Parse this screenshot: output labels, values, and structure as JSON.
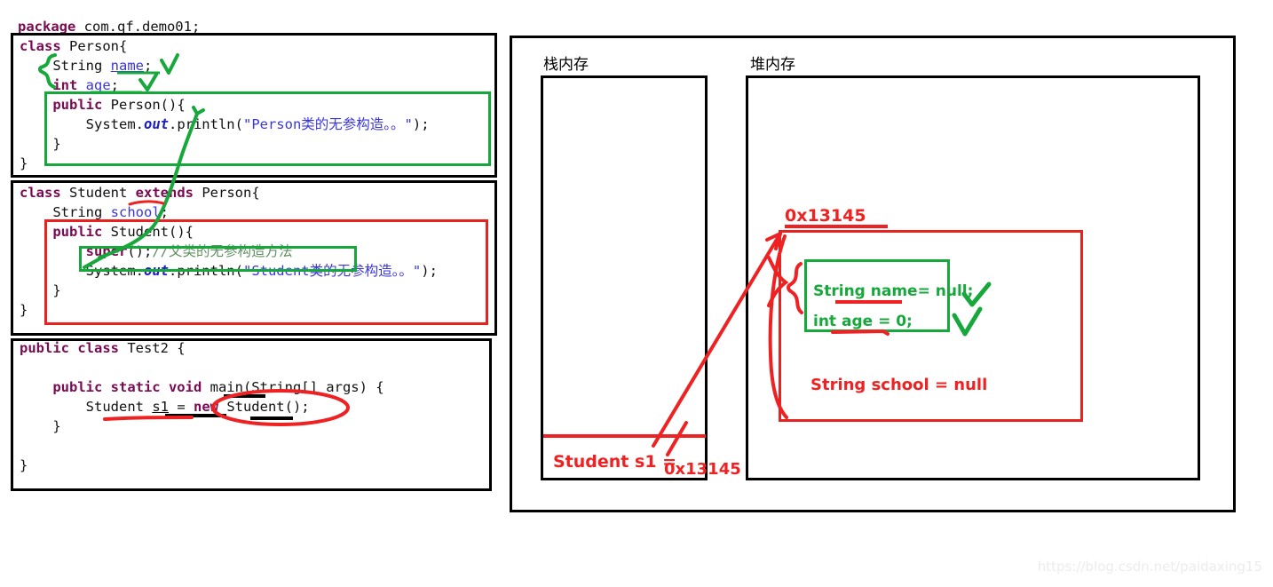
{
  "colors": {
    "keyword": "#7a0a52",
    "string": "#3a36d8",
    "field": "#3a36d8",
    "comment": "#5f8f5f",
    "red_ink": "#ee2222",
    "green_ink": "#17a83c",
    "border_black": "#000000",
    "watermark": "#ececec"
  },
  "code": {
    "package_line": "package com.qf.demo01;",
    "package_keyword": "package",
    "package_value": " com.qf.demo01;",
    "block_person": {
      "lines": [
        {
          "segs": [
            {
              "t": "class",
              "c": "kw"
            },
            {
              "t": " Person{",
              "c": "plain"
            }
          ]
        },
        {
          "segs": [
            {
              "t": "    String ",
              "c": "plain"
            },
            {
              "t": "name",
              "c": "fldu"
            },
            {
              "t": ";",
              "c": "plain"
            }
          ]
        },
        {
          "segs": [
            {
              "t": "    int",
              "c": "kw"
            },
            {
              "t": " ",
              "c": "plain"
            },
            {
              "t": "age",
              "c": "fld"
            },
            {
              "t": ";",
              "c": "plain"
            }
          ]
        },
        {
          "segs": [
            {
              "t": "    public",
              "c": "kw"
            },
            {
              "t": " Person(){",
              "c": "plain"
            }
          ]
        },
        {
          "segs": [
            {
              "t": "        System.",
              "c": "plain"
            },
            {
              "t": "out",
              "c": "out"
            },
            {
              "t": ".println(",
              "c": "plain"
            },
            {
              "t": "\"Person类的无参构造。。\"",
              "c": "str"
            },
            {
              "t": ");",
              "c": "plain"
            }
          ]
        },
        {
          "segs": [
            {
              "t": "    }",
              "c": "plain"
            }
          ]
        },
        {
          "segs": [
            {
              "t": "}",
              "c": "plain"
            }
          ]
        }
      ]
    },
    "block_student": {
      "lines": [
        {
          "segs": [
            {
              "t": "class",
              "c": "kw"
            },
            {
              "t": " Student ",
              "c": "plain"
            },
            {
              "t": "extends",
              "c": "kw"
            },
            {
              "t": " Person{",
              "c": "plain"
            }
          ]
        },
        {
          "segs": [
            {
              "t": "    String ",
              "c": "plain"
            },
            {
              "t": "school",
              "c": "fld"
            },
            {
              "t": ";",
              "c": "plain"
            }
          ]
        },
        {
          "segs": [
            {
              "t": "    public",
              "c": "kw"
            },
            {
              "t": " Student(){",
              "c": "plain"
            }
          ]
        },
        {
          "segs": [
            {
              "t": "        super",
              "c": "kw"
            },
            {
              "t": "();",
              "c": "plain"
            },
            {
              "t": "//父类的无参构造方法",
              "c": "cmt"
            }
          ]
        },
        {
          "segs": [
            {
              "t": "        System.",
              "c": "plain"
            },
            {
              "t": "out",
              "c": "out"
            },
            {
              "t": ".println(",
              "c": "plain"
            },
            {
              "t": "\"Student类的无参构造。。\"",
              "c": "str"
            },
            {
              "t": ");",
              "c": "plain"
            }
          ]
        },
        {
          "segs": [
            {
              "t": "    }",
              "c": "plain"
            }
          ]
        },
        {
          "segs": [
            {
              "t": "}",
              "c": "plain"
            }
          ]
        }
      ]
    },
    "block_test2": {
      "lines": [
        {
          "segs": [
            {
              "t": "public class",
              "c": "kw"
            },
            {
              "t": " Test2 {",
              "c": "plain"
            }
          ]
        },
        {
          "segs": [
            {
              "t": "",
              "c": "plain"
            }
          ]
        },
        {
          "segs": [
            {
              "t": "    public static void",
              "c": "kw"
            },
            {
              "t": " main(String[] args) {",
              "c": "plain"
            }
          ]
        },
        {
          "segs": [
            {
              "t": "        Student ",
              "c": "plain"
            },
            {
              "t": "s1",
              "c": "plain u"
            },
            {
              "t": " = ",
              "c": "plain"
            },
            {
              "t": "new",
              "c": "kw"
            },
            {
              "t": " Student();",
              "c": "plain"
            }
          ]
        },
        {
          "segs": [
            {
              "t": "    }",
              "c": "plain"
            }
          ]
        },
        {
          "segs": [
            {
              "t": "",
              "c": "plain"
            }
          ]
        },
        {
          "segs": [
            {
              "t": "}",
              "c": "plain"
            }
          ]
        }
      ]
    }
  },
  "diagram": {
    "stack_label": "栈内存",
    "heap_label": "堆内存",
    "heap_address": "0x13145",
    "stack_entry_name": "Student s1 = ",
    "stack_entry_value": "0x13145",
    "heap_fields": [
      {
        "text": "String name= null;",
        "color": "green"
      },
      {
        "text": "int age = 0;",
        "color": "green"
      },
      {
        "text": "String school = null",
        "color": "red"
      }
    ],
    "checkmarks": 2
  },
  "watermark": "https://blog.csdn.net/paidaxing15"
}
